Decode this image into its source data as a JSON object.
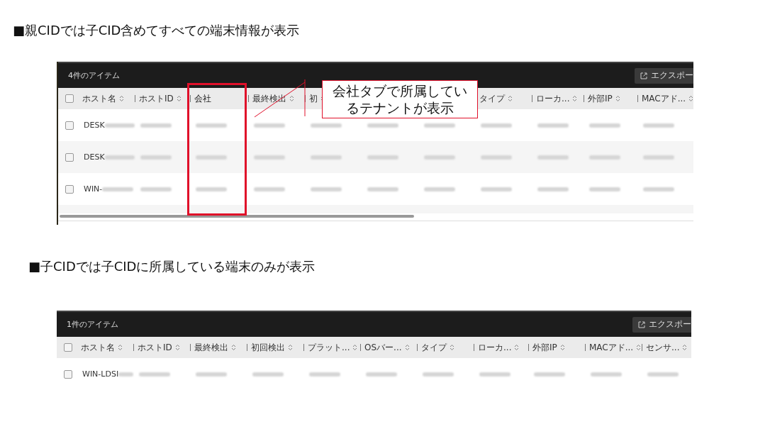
{
  "sections": [
    {
      "heading": "■親CIDでは子CID含めてすべての端末情報が表示",
      "table": {
        "item_count": "4件のアイテム",
        "export_button": "エクスポー",
        "header_checkbox": {
          "checked": false
        },
        "columns": [
          {
            "label": "ホスト名",
            "highlighted": false
          },
          {
            "label": "ホストID",
            "highlighted": false
          },
          {
            "label": "会社",
            "highlighted": true
          },
          {
            "label": "最終検出",
            "highlighted": false
          },
          {
            "label": "初",
            "highlighted": false
          },
          {
            "label": "タイプ",
            "highlighted": false
          },
          {
            "label": "ローカ...",
            "highlighted": false
          },
          {
            "label": "外部IP",
            "highlighted": false
          },
          {
            "label": "MACアド...",
            "highlighted": false
          }
        ],
        "rows": [
          {
            "checked": false,
            "cells": [
              {
                "text": "DESK",
                "blurred": true
              },
              {
                "blurred": true
              },
              {
                "blurred": true
              },
              {
                "blurred": true
              },
              {
                "blurred": true
              },
              {
                "blurred": true
              },
              {
                "blurred": true
              },
              {
                "blurred": true
              },
              {
                "blurred": true
              },
              {
                "blurred": true
              },
              {
                "blurred": true
              }
            ]
          },
          {
            "checked": false,
            "cells": [
              {
                "text": "DESK",
                "blurred": true
              },
              {
                "blurred": true
              },
              {
                "blurred": true
              },
              {
                "blurred": true
              },
              {
                "blurred": true
              },
              {
                "blurred": true
              },
              {
                "blurred": true
              },
              {
                "blurred": true
              },
              {
                "blurred": true
              },
              {
                "blurred": true
              },
              {
                "blurred": true
              }
            ]
          },
          {
            "checked": false,
            "cells": [
              {
                "text": "WIN-",
                "blurred": true
              },
              {
                "blurred": true
              },
              {
                "blurred": true
              },
              {
                "blurred": true
              },
              {
                "blurred": true
              },
              {
                "blurred": true
              },
              {
                "blurred": true
              },
              {
                "blurred": true
              },
              {
                "blurred": true
              },
              {
                "blurred": true
              },
              {
                "blurred": true
              }
            ]
          }
        ],
        "more_rows": true,
        "callout": "会社タブで所属しているテナントが表示"
      }
    },
    {
      "heading": "■子CIDでは子CIDに所属している端末のみが表示",
      "table": {
        "item_count": "1件のアイテム",
        "export_button": "エクスポー",
        "header_checkbox": {
          "checked": false
        },
        "columns": [
          {
            "label": "ホスト名",
            "highlighted": false
          },
          {
            "label": "ホストID",
            "highlighted": false
          },
          {
            "label": "最終検出",
            "highlighted": false
          },
          {
            "label": "初回検出",
            "highlighted": false
          },
          {
            "label": "プラット...",
            "highlighted": false
          },
          {
            "label": "OSバー...",
            "highlighted": false
          },
          {
            "label": "タイプ",
            "highlighted": false
          },
          {
            "label": "ローカ...",
            "highlighted": false
          },
          {
            "label": "外部IP",
            "highlighted": false
          },
          {
            "label": "MACアド...",
            "highlighted": false
          },
          {
            "label": "センサ...",
            "highlighted": false
          }
        ],
        "rows": [
          {
            "checked": false,
            "cells": [
              {
                "text": "WIN-LDSI",
                "blurred": true
              },
              {
                "blurred": true
              },
              {
                "blurred": true
              },
              {
                "blurred": true
              },
              {
                "blurred": true
              },
              {
                "blurred": true
              },
              {
                "blurred": true
              },
              {
                "blurred": true
              },
              {
                "blurred": true
              },
              {
                "blurred": true
              },
              {
                "blurred": true
              }
            ]
          }
        ]
      }
    }
  ]
}
